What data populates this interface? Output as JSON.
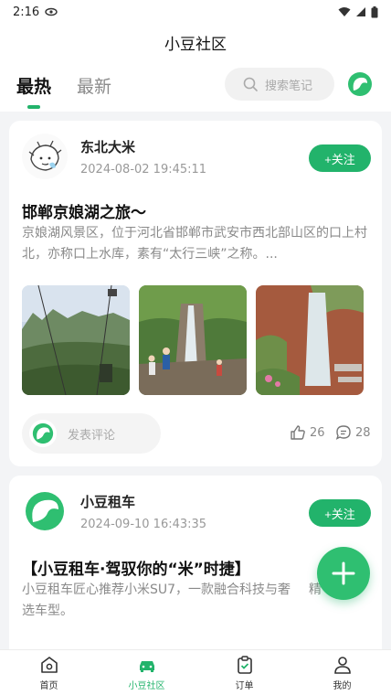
{
  "status_bar": {
    "time": "2:16"
  },
  "header": {
    "title": "小豆社区"
  },
  "tabs": [
    {
      "label": "最热",
      "active": true
    },
    {
      "label": "最新",
      "active": false
    }
  ],
  "search": {
    "placeholder": "搜索笔记"
  },
  "posts": [
    {
      "author": "东北大米",
      "date": "2024-08-02 19:45:11",
      "follow_label": "+关注",
      "title": "邯郸京娘湖之旅～",
      "body": "京娘湖风景区，位于河北省邯郸市武安市西北部山区的口上村北，亦称口上水库，素有“太行三峡”之称。...",
      "comment_placeholder": "发表评论",
      "likes": "26",
      "comments": "28"
    },
    {
      "author": "小豆租车",
      "date": "2024-09-10 16:43:35",
      "follow_label": "+关注",
      "title": "【小豆租车·驾驭你的“米”时捷】",
      "body_line1": "小豆租车匠心推荐小米SU7，一款融合科技与奢",
      "body_line1_tail": "精",
      "body_line2": "选车型。"
    }
  ],
  "fab": {
    "icon": "plus-icon"
  },
  "bottom_nav": [
    {
      "label": "首页",
      "icon": "home-icon",
      "active": false
    },
    {
      "label": "小豆社区",
      "icon": "community-icon",
      "active": true
    },
    {
      "label": "订单",
      "icon": "order-icon",
      "active": false
    },
    {
      "label": "我的",
      "icon": "profile-icon",
      "active": false
    }
  ],
  "colors": {
    "accent": "#22b36b",
    "background": "#f3f4f6"
  }
}
